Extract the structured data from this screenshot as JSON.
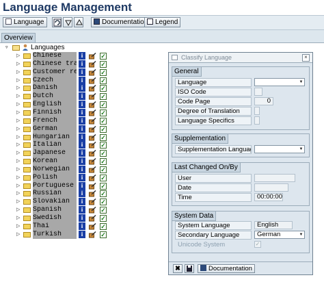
{
  "window": {
    "title": "Language Management"
  },
  "toolbar": {
    "language_label": "Language",
    "documentation_label": "Documentation",
    "legend_label": "Legend"
  },
  "tabs": {
    "overview": "Overview"
  },
  "tree": {
    "root_label": "Languages",
    "languages": [
      "Chinese",
      "Chinese trad.",
      "Customer reser",
      "Czech",
      "Danish",
      "Dutch",
      "English",
      "Finnish",
      "French",
      "German",
      "Hungarian",
      "Italian",
      "Japanese",
      "Korean",
      "Norwegian",
      "Polish",
      "Portuguese",
      "Russian",
      "Slovakian",
      "Spanish",
      "Swedish",
      "Thai",
      "Turkish"
    ],
    "info_icon": "info-icon",
    "edit_icon": "edit-icon",
    "check_icon": "check-icon"
  },
  "dialog": {
    "title": "Classify Language",
    "general": {
      "title": "General",
      "language_label": "Language",
      "iso_code_label": "ISO Code",
      "code_page_label": "Code Page",
      "code_page_value": "0",
      "degree_label": "Degree of Translation",
      "specifics_label": "Language Specifics"
    },
    "supplementation": {
      "title": "Supplementation",
      "language_label": "Supplementation Language"
    },
    "last_changed": {
      "title": "Last Changed On/By",
      "user_label": "User",
      "date_label": "Date",
      "time_label": "Time",
      "time_value": "00:00:00"
    },
    "system_data": {
      "title": "System Data",
      "system_language_label": "System Language",
      "system_language_value": "English",
      "secondary_language_label": "Secondary Language",
      "secondary_language_value": "German",
      "unicode_label": "Unicode System",
      "unicode_checked": true
    },
    "footer": {
      "documentation_label": "Documentation"
    }
  }
}
